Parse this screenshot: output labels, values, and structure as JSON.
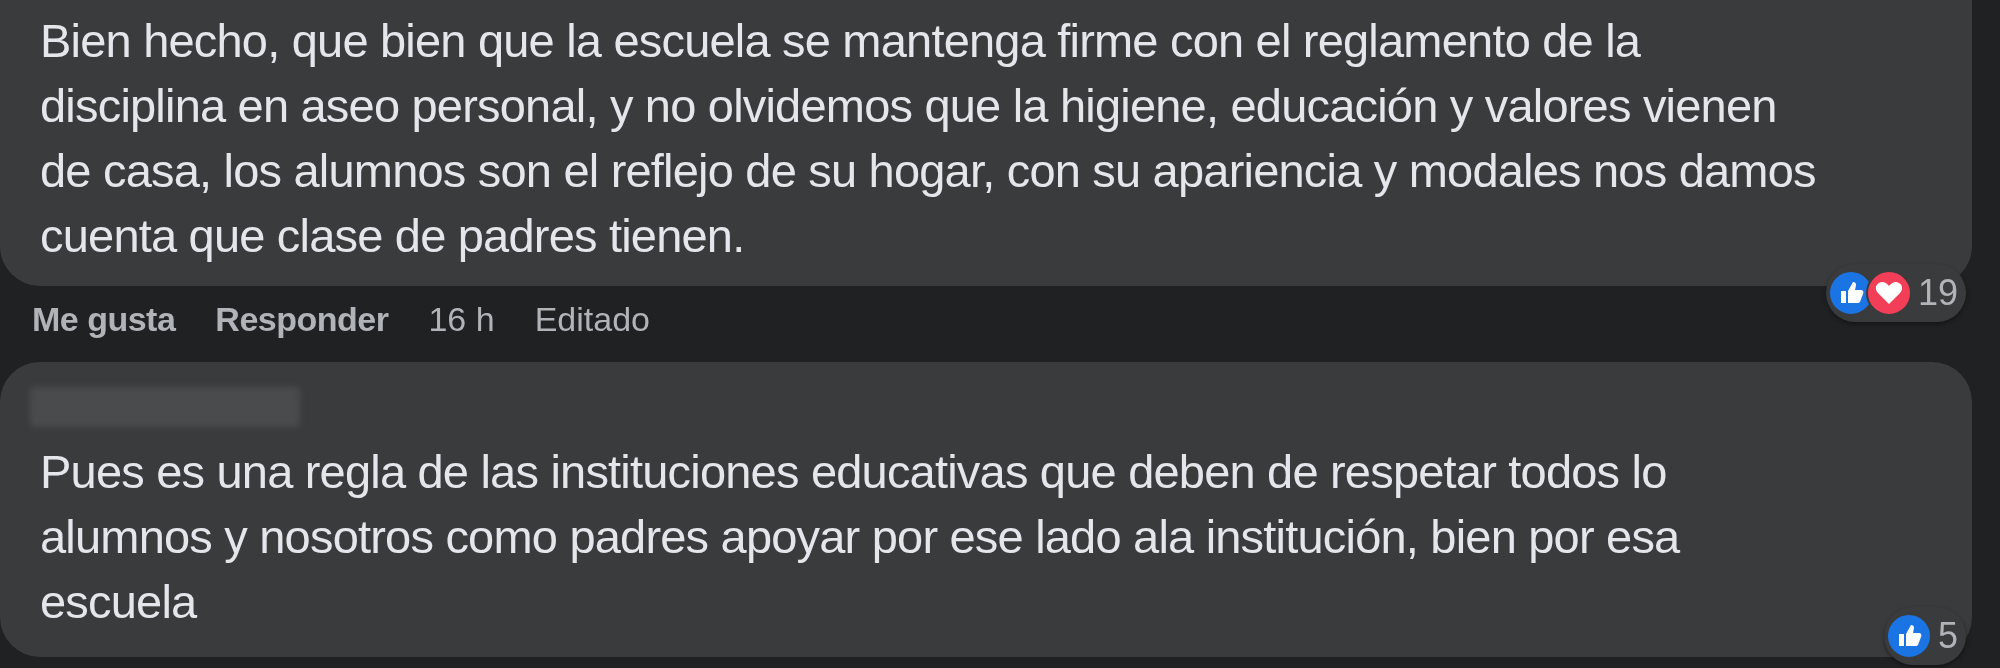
{
  "comments": [
    {
      "lines": [
        "Bien hecho, que bien que la escuela se mantenga firme con el reglamento de la",
        "disciplina en aseo personal, y no olvidemos que la higiene, educación y valores vienen",
        "de casa, los alumnos son el reflejo de su hogar, con su apariencia y modales nos damos",
        "cuenta que clase de padres tienen."
      ],
      "reactions": [
        {
          "kind": "like"
        },
        {
          "kind": "love"
        }
      ],
      "reaction_count": "19",
      "actions": [
        {
          "kind": "link",
          "text": "Me gusta"
        },
        {
          "kind": "link",
          "text": "Responder"
        },
        {
          "kind": "meta",
          "text": "16 h"
        },
        {
          "kind": "meta",
          "text": "Editado"
        }
      ],
      "top_cut": true
    },
    {
      "author_blurred": true,
      "lines": [
        "Pues es una regla de las instituciones educativas que deben de respetar todos lo",
        "alumnos y nosotros como padres apoyar por ese lado ala institución, bien por esa",
        "escuela"
      ],
      "reactions": [
        {
          "kind": "like"
        }
      ],
      "reaction_count": "5"
    }
  ]
}
